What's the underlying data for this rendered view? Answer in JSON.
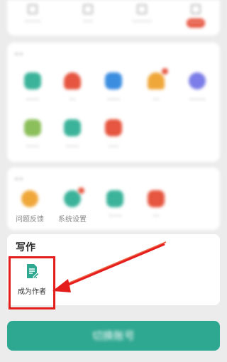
{
  "top_tabs": [
    {
      "label": "•••••"
    },
    {
      "label": "•••"
    },
    {
      "label": "••••••"
    },
    {
      "label": "••••"
    }
  ],
  "sections": {
    "reading": {
      "title": "••",
      "items": [
        {
          "label": "••••",
          "icon": "briefcase-icon",
          "color": "#3bb39a"
        },
        {
          "label": "••",
          "icon": "user-icon",
          "color": "#e6553f"
        },
        {
          "label": "••••",
          "icon": "chat-icon",
          "color": "#3b8de0"
        },
        {
          "label": "••",
          "icon": "bell-icon",
          "color": "#f0a73a"
        },
        {
          "label": "•••••",
          "icon": "planet-icon",
          "color": "#7c7de8"
        },
        {
          "label": "••••",
          "icon": "leaf-icon",
          "color": "#8bbf5b"
        },
        {
          "label": "••••",
          "icon": "book-icon",
          "color": "#3bb39a"
        },
        {
          "label": "•••",
          "icon": "gift-icon",
          "color": "#e6553f"
        }
      ]
    },
    "other": {
      "title": "••",
      "items": [
        {
          "label": "问题反馈",
          "icon": "question-icon",
          "color": "#f0a73a"
        },
        {
          "label": "系统设置",
          "icon": "settings-icon",
          "color": "#3bb39a"
        },
        {
          "label": "••••",
          "icon": "grid-icon",
          "color": "#3bb39a"
        },
        {
          "label": "••",
          "icon": "shirt-icon",
          "color": "#e6553f"
        }
      ]
    },
    "write": {
      "title": "写作",
      "become_author": "成为作者"
    }
  },
  "switch_account": "切换账号",
  "colors": {
    "accent": "#2fa891",
    "highlight": "#e51c1c"
  }
}
